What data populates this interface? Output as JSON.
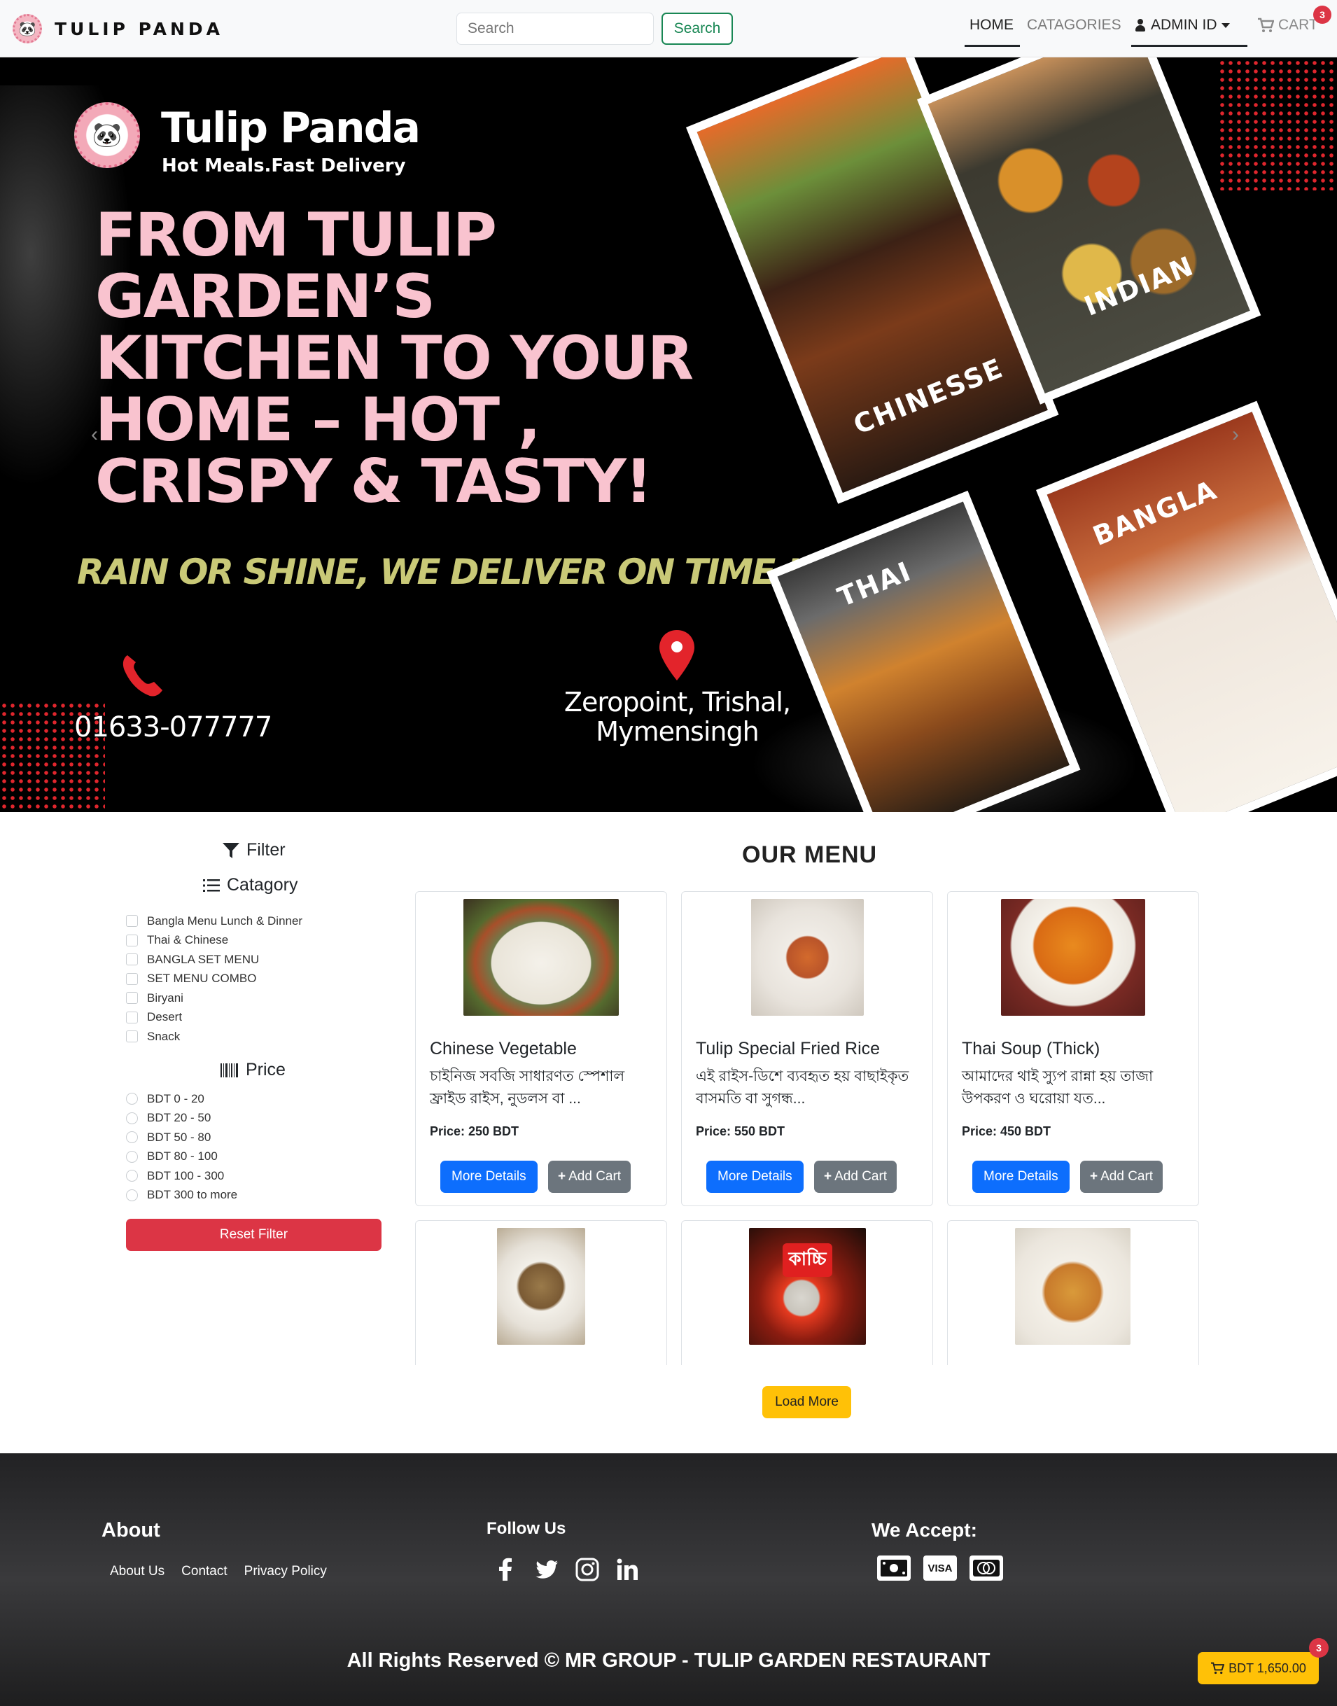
{
  "navbar": {
    "brand": "TULIP PANDA",
    "search_placeholder": "Search",
    "search_button": "Search",
    "home": "HOME",
    "categories": "CATAGORIES",
    "admin": "ADMIN ID",
    "cart": "CART",
    "cart_count": "3"
  },
  "hero": {
    "brand": "Tulip Panda",
    "tagline": "Hot Meals.Fast Delivery",
    "headline": "FROM TULIP GARDEN’S KITCHEN TO YOUR HOME – HOT , CRISPY & TASTY!",
    "slogan": "RAIN OR SHINE, WE DELIVER ON TIME !",
    "phone": "01633-077777",
    "address_line1": "Zeropoint, Trishal,",
    "address_line2": "Mymensingh",
    "cuisines": [
      "CHINESSE",
      "INDIAN",
      "THAI",
      "BANGLA"
    ],
    "prev": "‹",
    "next": "›"
  },
  "sidebar": {
    "filter_title": "Filter",
    "category_title": "Catagory",
    "categories": [
      "Bangla Menu Lunch & Dinner",
      "Thai & Chinese",
      "BANGLA SET MENU",
      "SET MENU COMBO",
      "Biryani",
      "Desert",
      "Snack"
    ],
    "price_title": "Price",
    "prices": [
      "BDT 0 - 20",
      "BDT 20 - 50",
      "BDT 50 - 80",
      "BDT 80 - 100",
      "BDT 100 - 300",
      "BDT 300 to more"
    ],
    "reset": "Reset Filter"
  },
  "menu": {
    "title": "OUR MENU",
    "more_details": "More Details",
    "add_cart": "Add Cart",
    "items": [
      {
        "name": "Chinese Vegetable",
        "desc": "চাইনিজ সবজি সাধারণত স্পেশাল ফ্রাইড রাইস, নুডলস বা ...",
        "price": "Price: 250 BDT"
      },
      {
        "name": "Tulip Special Fried Rice",
        "desc": "এই রাইস-ডিশে ব্যবহৃত হয় বাছাইকৃত বাসমতি বা সুগন্ধ...",
        "price": "Price: 550 BDT"
      },
      {
        "name": "Thai Soup (Thick)",
        "desc": "আমাদের থাই স্যুপ রান্না হয় তাজা উপকরণ ও ঘরোয়া যত...",
        "price": "Price: 450 BDT"
      }
    ],
    "promo_text": "কাচ্চি",
    "load_more": "Load More"
  },
  "footer": {
    "about_title": "About",
    "links": [
      "About Us",
      "Contact",
      "Privacy Policy"
    ],
    "follow_title": "Follow Us",
    "accept_title": "We Accept:",
    "visa": "VISA",
    "copyright": "All Rights Reserved © MR GROUP -  TULIP GARDEN RESTAURANT"
  },
  "float_cart": {
    "total": "BDT 1,650.00",
    "count": "3"
  },
  "colors": {
    "primary": "#0d6efd",
    "danger": "#dc3545",
    "success": "#198754",
    "warning": "#ffc107",
    "secondary": "#6c757d",
    "hero_pink": "#f9c3cf"
  }
}
